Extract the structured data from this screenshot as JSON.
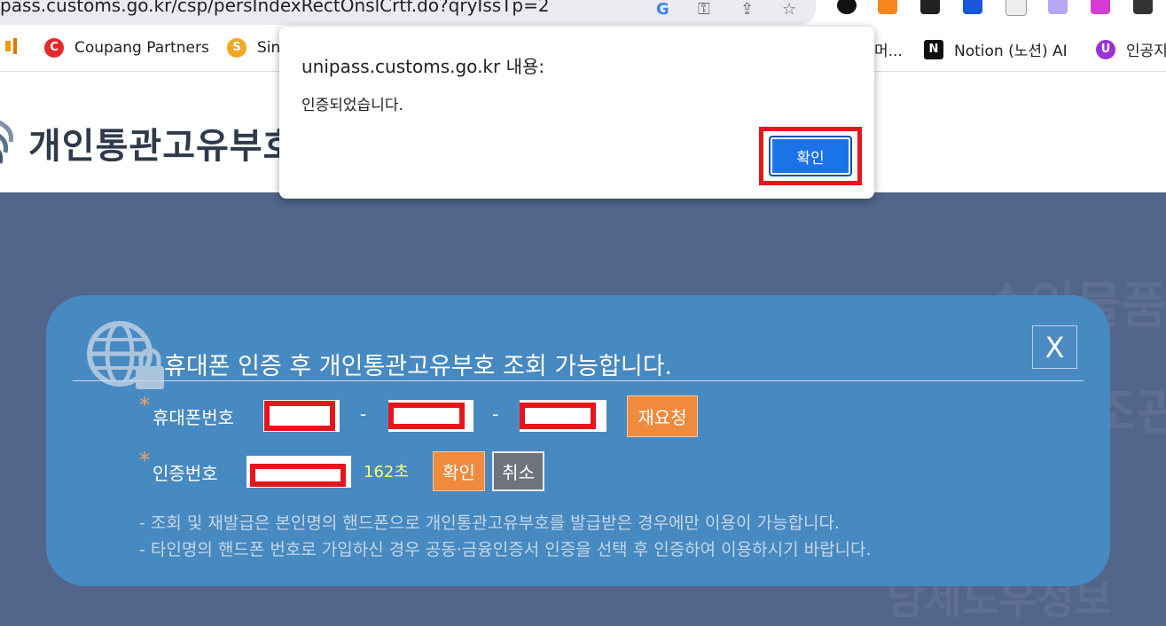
{
  "browser": {
    "url": "pass.customs.go.kr/csp/persIndexRectOnslCrtf.do?qryIssTp=2",
    "bookmarks": [
      {
        "label": "Coupang Partners"
      },
      {
        "label": "Sin"
      },
      {
        "label": "머..."
      },
      {
        "label": "Notion (노션) AI"
      },
      {
        "label": "인공지"
      }
    ]
  },
  "page": {
    "logo_text": "개인통관고유부호"
  },
  "alert": {
    "title": "unipass.customs.go.kr 내용:",
    "message": "인증되었습니다.",
    "ok_label": "확인"
  },
  "panel": {
    "title": "휴대폰 인증 후 개인통관고유부호 조회 가능합니다.",
    "close_label": "X",
    "phone_label": "휴대폰번호",
    "phone_separator": "-",
    "resend_label": "재요청",
    "code_label": "인증번호",
    "timer": "162초",
    "confirm_label": "확인",
    "cancel_label": "취소",
    "required_mark": "*",
    "notes": [
      "- 조회 및 재발급은 본인명의 핸드폰으로 개인통관고유부호를 발급받은 경우에만 이용이 가능합니다.",
      "- 타인명의 핸드폰 번호로 가입하신 경우 공동·금융인증서 인증을 선택 후 인증하여 이용하시기 바랍니다."
    ]
  },
  "colors": {
    "panel_bg": "#4789c1",
    "page_bg": "#52658a",
    "alert_button": "#1a73e8",
    "highlight_red": "#e8141c",
    "orange_button": "#f08a3c",
    "timer_yellow": "#ffff6a"
  }
}
